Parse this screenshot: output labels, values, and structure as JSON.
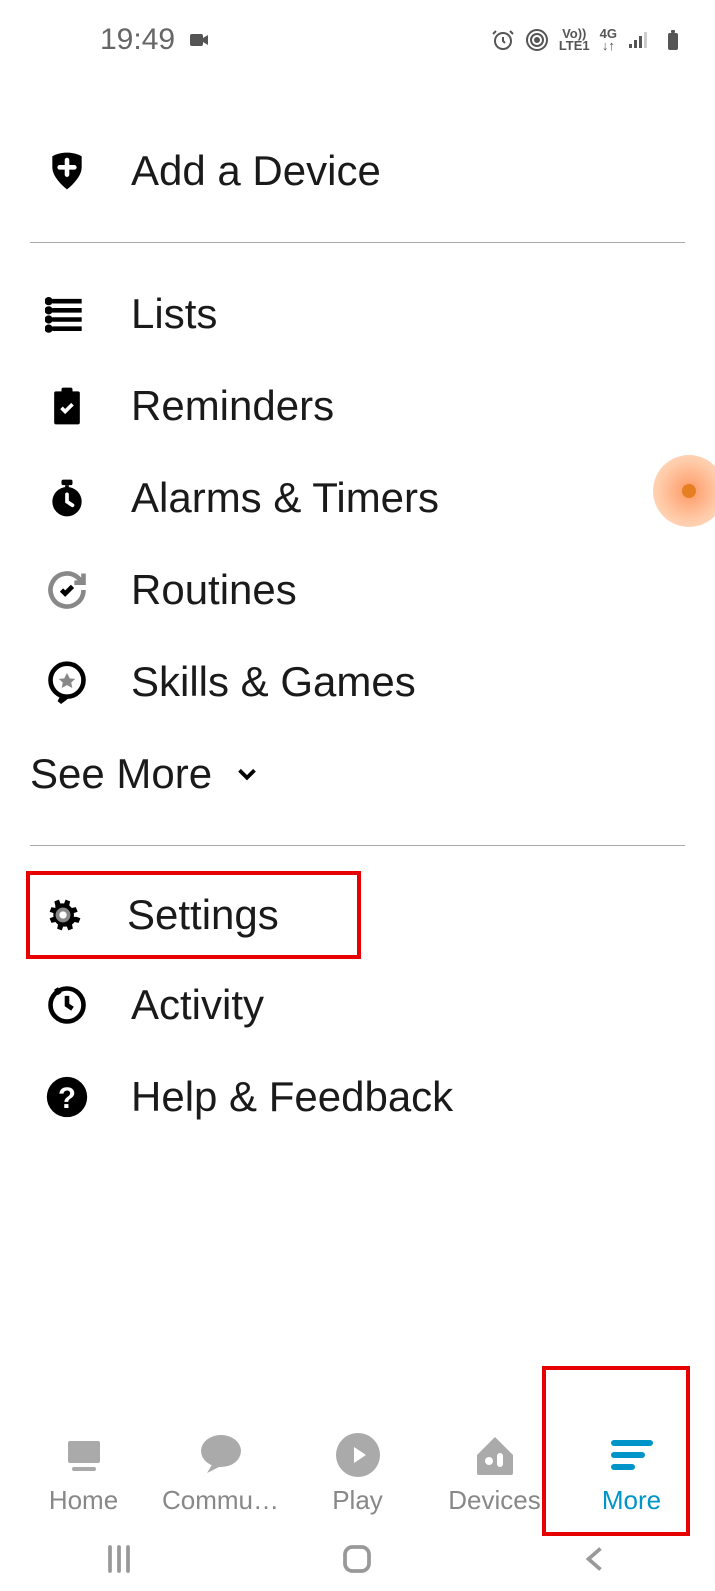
{
  "status": {
    "time": "19:49"
  },
  "menu": {
    "addDevice": "Add a Device",
    "lists": "Lists",
    "reminders": "Reminders",
    "alarms": "Alarms & Timers",
    "routines": "Routines",
    "skills": "Skills & Games",
    "seeMore": "See More",
    "settings": "Settings",
    "activity": "Activity",
    "help": "Help & Feedback"
  },
  "nav": {
    "home": "Home",
    "communicate": "Commu…",
    "play": "Play",
    "devices": "Devices",
    "more": "More"
  }
}
